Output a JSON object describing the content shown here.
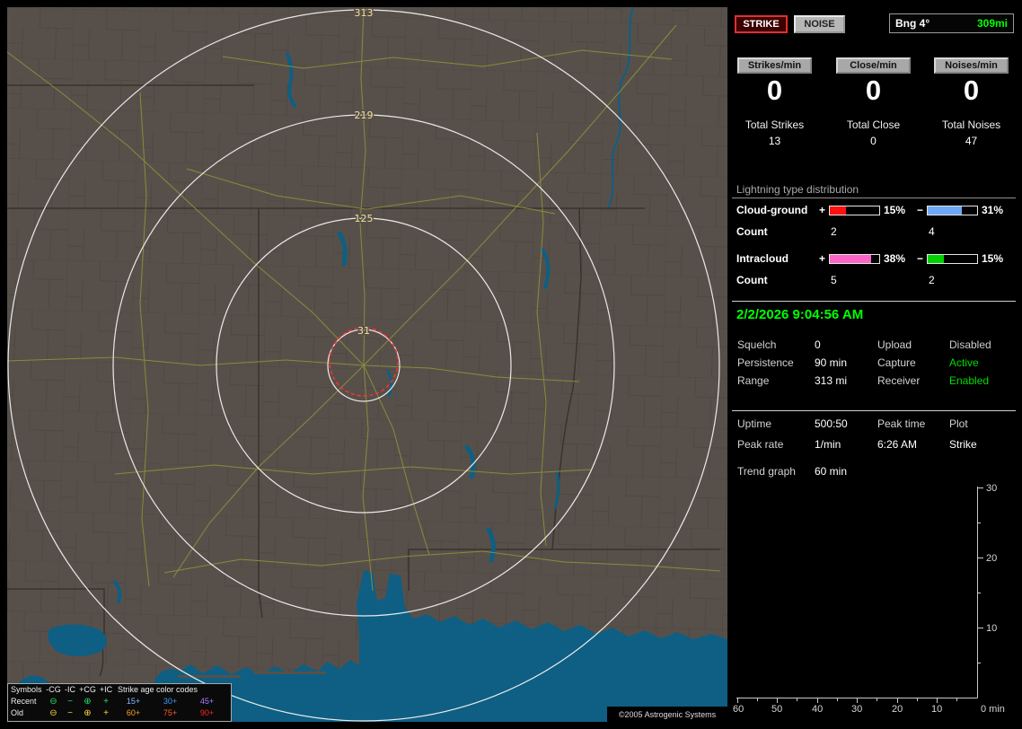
{
  "colors": {
    "accent_green": "#00ff00",
    "status_green": "#00dd00",
    "map_land": "#57504a",
    "map_water": "#0e5f83",
    "map_road": "#8f8d3c",
    "range_ring": "#eaeaea",
    "ring_label": "#f4e29b",
    "alarm_ring": "#ff3030"
  },
  "map": {
    "rings": [
      "313",
      "219",
      "125",
      "31"
    ],
    "copyright": "©2005 Astrogenic Systems",
    "legend": {
      "title": "Symbols",
      "age_title": "Strike age color codes",
      "columns": [
        "-CG",
        "-IC",
        "+CG",
        "+IC"
      ],
      "rows": [
        {
          "label": "Recent",
          "icon_color": "#25e06a",
          "icons": [
            "⊖",
            "−",
            "⊕",
            "+"
          ],
          "ages": [
            {
              "text": "15+",
              "color": "#8cb8ff"
            },
            {
              "text": "30+",
              "color": "#3d9bff"
            },
            {
              "text": "45+",
              "color": "#a87cff"
            }
          ]
        },
        {
          "label": "Old",
          "icon_color": "#ffd23c",
          "icons": [
            "⊖",
            "−",
            "⊕",
            "+"
          ],
          "ages": [
            {
              "text": "60+",
              "color": "#ffa21e"
            },
            {
              "text": "75+",
              "color": "#ff5c1e"
            },
            {
              "text": "90+",
              "color": "#ff2222"
            }
          ]
        }
      ]
    }
  },
  "panel": {
    "strike_button": "STRIKE",
    "noise_button": "NOISE",
    "bearing_label": "Bng 4°",
    "bearing_distance": "309mi",
    "counters": [
      {
        "label": "Strikes/min",
        "value": "0",
        "total_label": "Total Strikes",
        "total": "13"
      },
      {
        "label": "Close/min",
        "value": "0",
        "total_label": "Total Close",
        "total": "0"
      },
      {
        "label": "Noises/min",
        "value": "0",
        "total_label": "Total Noises",
        "total": "47"
      }
    ],
    "distribution": {
      "title": "Lightning type distribution",
      "signs": {
        "plus": "+",
        "minus": "−"
      },
      "rows": [
        {
          "label": "Cloud-ground",
          "count_label": "Count",
          "pos": {
            "pct": 15,
            "text": "15%",
            "count": "2",
            "color": "#ff1010"
          },
          "neg": {
            "pct": 31,
            "text": "31%",
            "count": "4",
            "color": "#6fa8f5"
          }
        },
        {
          "label": "Intracloud",
          "count_label": "Count",
          "pos": {
            "pct": 38,
            "text": "38%",
            "count": "5",
            "color": "#ff64c8"
          },
          "neg": {
            "pct": 15,
            "text": "15%",
            "count": "2",
            "color": "#00d200"
          }
        }
      ]
    },
    "datetime": "2/2/2026 9:04:56 AM",
    "status": [
      {
        "label": "Squelch",
        "value": "0",
        "label2": "Upload",
        "value2": "Disabled",
        "value2_color": "#cccccc"
      },
      {
        "label": "Persistence",
        "value": "90 min",
        "label2": "Capture",
        "value2": "Active",
        "value2_color": "#00dd00"
      },
      {
        "label": "Range",
        "value": "313 mi",
        "label2": "Receiver",
        "value2": "Enabled",
        "value2_color": "#00dd00"
      }
    ],
    "stats": {
      "uptime_label": "Uptime",
      "uptime_value": "500:50",
      "peak_time_label": "Peak time",
      "peak_time_value": "6:26 AM",
      "plot_label": "Plot",
      "plot_value": "Strike",
      "peak_rate_label": "Peak rate",
      "peak_rate_value": "1/min",
      "trend_label": "Trend graph",
      "trend_value": "60 min"
    },
    "graph": {
      "y_ticks": [
        "30",
        "20",
        "10"
      ],
      "x_ticks": [
        "60",
        "50",
        "40",
        "30",
        "20",
        "10"
      ],
      "origin_label": "0 min"
    }
  }
}
